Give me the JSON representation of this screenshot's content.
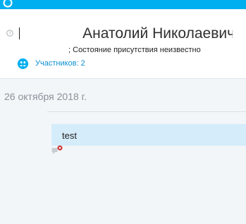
{
  "window": {
    "accent_color": "#00aff0"
  },
  "header": {
    "contact_name": "Ha... ...н Анатолий Николаевич",
    "presence_separator": ";",
    "presence_text": "Состояние присутствия неизвестно",
    "participants_label": "Участников: 2",
    "participants_icon": "people-icon",
    "status_icon": "question-status-icon"
  },
  "conversation": {
    "date_label": "26 октября 2018 г.",
    "messages": [
      {
        "text": "test",
        "status_icon": "message-failed-icon"
      }
    ]
  }
}
